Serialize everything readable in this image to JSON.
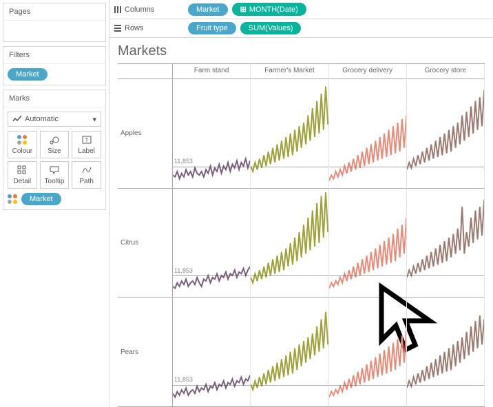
{
  "sidebar": {
    "pages_title": "Pages",
    "filters_title": "Filters",
    "filter_pill": "Market",
    "marks_title": "Marks",
    "marks_select": "Automatic",
    "buttons": [
      "Colour",
      "Size",
      "Label",
      "Detail",
      "Tooltip",
      "Path"
    ],
    "encoding_pill": "Market"
  },
  "shelves": {
    "columns_label": "Columns",
    "rows_label": "Rows",
    "columns_pills": [
      "Market",
      "MONTH(Date)"
    ],
    "rows_pills": [
      "Fruit type",
      "SUM(Values)"
    ]
  },
  "viz": {
    "title": "Markets",
    "col_headers": [
      "Farm stand",
      "Farmer's Market",
      "Grocery delivery",
      "Grocery store"
    ],
    "row_headers": [
      "Apples",
      "Citrus",
      "Pears"
    ],
    "ref_label": "11,853",
    "colors": {
      "Farm stand": "#7a5f7d",
      "Farmer's Market": "#a0a138",
      "Grocery delivery": "#e88a78",
      "Grocery store": "#9a7a70"
    }
  },
  "chart_data": {
    "type": "line",
    "title": "Markets",
    "facet_cols": [
      "Farm stand",
      "Farmer's Market",
      "Grocery delivery",
      "Grocery store"
    ],
    "facet_rows": [
      "Apples",
      "Citrus",
      "Pears"
    ],
    "x_field": "MONTH(Date)",
    "y_field": "SUM(Values)",
    "colour_field": "Market",
    "reference_line": 11853,
    "ylim_approx": [
      0,
      60000
    ],
    "note": "Monthly time series per Fruit type × Market; values estimated from pixel heights since y-axis ticks are not labeled.",
    "series": {
      "Apples": {
        "Farm stand": [
          7000,
          6000,
          9000,
          5000,
          8000,
          6000,
          10000,
          7000,
          9000,
          6000,
          11000,
          8000,
          7000,
          9000,
          6000,
          10000,
          8000,
          12000,
          7000,
          11000,
          9000,
          13000,
          8000,
          12000,
          10000,
          14000,
          9000,
          13000,
          11000,
          15000,
          10000,
          14000,
          12000,
          16000,
          11000,
          15000
        ],
        "Farmer's Market": [
          12000,
          9000,
          14000,
          10000,
          16000,
          11000,
          18000,
          12000,
          20000,
          13000,
          22000,
          14000,
          24000,
          15000,
          26000,
          16000,
          28000,
          17000,
          30000,
          18000,
          32000,
          20000,
          34000,
          22000,
          36000,
          24000,
          40000,
          26000,
          44000,
          28000,
          48000,
          30000,
          52000,
          32000,
          56000,
          35000
        ],
        "Grocery delivery": [
          4000,
          7000,
          5000,
          9000,
          6000,
          10000,
          7000,
          12000,
          8000,
          14000,
          9000,
          16000,
          10000,
          18000,
          11000,
          20000,
          12000,
          22000,
          13000,
          24000,
          14000,
          26000,
          15000,
          28000,
          16000,
          30000,
          17000,
          32000,
          18000,
          34000,
          19000,
          36000,
          20000,
          38000,
          22000,
          40000
        ],
        "Grocery store": [
          10000,
          14000,
          11000,
          16000,
          12000,
          18000,
          13000,
          20000,
          14000,
          22000,
          15000,
          24000,
          16000,
          26000,
          17000,
          28000,
          18000,
          30000,
          19000,
          32000,
          20000,
          34000,
          22000,
          36000,
          24000,
          40000,
          26000,
          42000,
          28000,
          45000,
          30000,
          48000,
          32000,
          50000,
          34000,
          54000
        ]
      },
      "Citrus": {
        "Farm stand": [
          6000,
          5000,
          8000,
          6000,
          9000,
          7000,
          10000,
          6000,
          8000,
          9000,
          7000,
          11000,
          8000,
          6000,
          10000,
          9000,
          12000,
          8000,
          11000,
          10000,
          13000,
          9000,
          12000,
          11000,
          14000,
          10000,
          13000,
          12000,
          15000,
          11000,
          14000,
          13000,
          16000,
          12000,
          15000,
          17000
        ],
        "Farmer's Market": [
          11000,
          8000,
          13000,
          9000,
          15000,
          10000,
          17000,
          11000,
          19000,
          12000,
          21000,
          13000,
          23000,
          14000,
          25000,
          15000,
          27000,
          17000,
          30000,
          18000,
          33000,
          20000,
          36000,
          22000,
          40000,
          24000,
          44000,
          26000,
          48000,
          28000,
          52000,
          30000,
          56000,
          33000,
          58000,
          36000
        ],
        "Grocery delivery": [
          5000,
          8000,
          6000,
          9000,
          7000,
          11000,
          8000,
          13000,
          9000,
          15000,
          10000,
          17000,
          11000,
          19000,
          12000,
          21000,
          13000,
          23000,
          14000,
          25000,
          15000,
          27000,
          16000,
          29000,
          17000,
          31000,
          18000,
          33000,
          19000,
          35000,
          20000,
          38000,
          22000,
          40000,
          24000,
          44000
        ],
        "Grocery store": [
          11000,
          15000,
          12000,
          17000,
          13000,
          19000,
          14000,
          21000,
          15000,
          23000,
          16000,
          25000,
          17000,
          27000,
          18000,
          29000,
          19000,
          31000,
          20000,
          33000,
          22000,
          35000,
          24000,
          38000,
          26000,
          50000,
          24000,
          36000,
          28000,
          44000,
          30000,
          48000,
          32000,
          50000,
          34000,
          54000
        ]
      },
      "Pears": {
        "Farm stand": [
          7000,
          5000,
          8000,
          6000,
          9000,
          7000,
          10000,
          6000,
          8000,
          9000,
          7000,
          11000,
          8000,
          10000,
          9000,
          12000,
          8000,
          11000,
          10000,
          13000,
          9000,
          12000,
          11000,
          14000,
          10000,
          13000,
          12000,
          15000,
          11000,
          14000,
          13000,
          16000,
          12000,
          15000,
          14000,
          17000
        ],
        "Farmer's Market": [
          12000,
          9000,
          14000,
          10000,
          16000,
          11000,
          18000,
          12000,
          20000,
          13000,
          22000,
          14000,
          24000,
          15000,
          26000,
          16000,
          28000,
          17000,
          30000,
          18000,
          32000,
          20000,
          34000,
          22000,
          36000,
          24000,
          38000,
          26000,
          40000,
          28000,
          44000,
          30000,
          48000,
          32000,
          52000,
          34000
        ],
        "Grocery delivery": [
          5000,
          8000,
          6000,
          9000,
          7000,
          11000,
          8000,
          13000,
          9000,
          15000,
          10000,
          17000,
          11000,
          19000,
          12000,
          21000,
          13000,
          23000,
          14000,
          25000,
          15000,
          27000,
          16000,
          29000,
          17000,
          31000,
          18000,
          33000,
          19000,
          35000,
          20000,
          37000,
          22000,
          39000,
          24000,
          42000
        ],
        "Grocery store": [
          10000,
          14000,
          11000,
          16000,
          12000,
          18000,
          13000,
          20000,
          14000,
          22000,
          15000,
          24000,
          16000,
          26000,
          17000,
          28000,
          18000,
          30000,
          19000,
          32000,
          20000,
          34000,
          22000,
          36000,
          24000,
          38000,
          26000,
          41000,
          28000,
          44000,
          30000,
          47000,
          32000,
          50000,
          34000,
          48000
        ]
      }
    }
  }
}
